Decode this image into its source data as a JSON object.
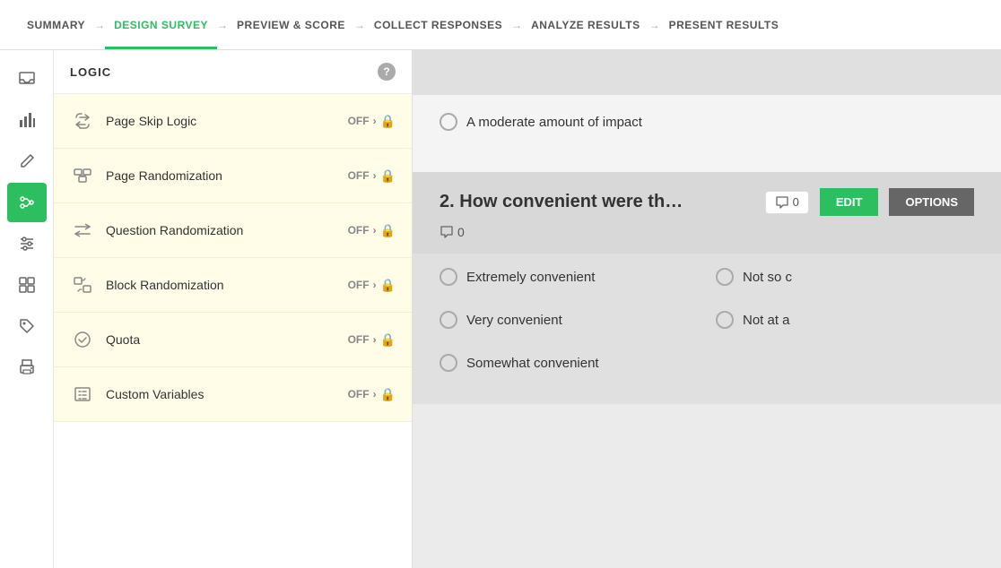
{
  "nav": {
    "items": [
      {
        "id": "summary",
        "label": "SUMMARY",
        "active": false
      },
      {
        "id": "design",
        "label": "DESIGN SURVEY",
        "active": true
      },
      {
        "id": "preview",
        "label": "PREVIEW & SCORE",
        "active": false
      },
      {
        "id": "collect",
        "label": "COLLECT RESPONSES",
        "active": false
      },
      {
        "id": "analyze",
        "label": "ANALYZE RESULTS",
        "active": false
      },
      {
        "id": "present",
        "label": "PRESENT RESULTS",
        "active": false
      }
    ]
  },
  "sidebar_icons": [
    {
      "id": "inbox",
      "icon": "⊟",
      "active": false
    },
    {
      "id": "chart",
      "icon": "▦",
      "active": false
    },
    {
      "id": "edit",
      "icon": "✎",
      "active": false
    },
    {
      "id": "logic",
      "icon": "⚡",
      "active": true
    },
    {
      "id": "settings",
      "icon": "⊞",
      "active": false
    },
    {
      "id": "grid",
      "icon": "⊞",
      "active": false
    },
    {
      "id": "tag",
      "icon": "⬡",
      "active": false
    },
    {
      "id": "print",
      "icon": "⎙",
      "active": false
    }
  ],
  "logic": {
    "title": "LOGIC",
    "help_label": "?",
    "items": [
      {
        "id": "page-skip",
        "icon": "skip",
        "label": "Page Skip Logic",
        "status": "OFF"
      },
      {
        "id": "page-randomization",
        "icon": "random",
        "label": "Page Randomization",
        "status": "OFF"
      },
      {
        "id": "question-randomization",
        "icon": "shuffle",
        "label": "Question Randomization",
        "status": "OFF"
      },
      {
        "id": "block-randomization",
        "icon": "block",
        "label": "Block Randomization",
        "status": "OFF"
      },
      {
        "id": "quota",
        "icon": "check-circle",
        "label": "Quota",
        "status": "OFF"
      },
      {
        "id": "custom-variables",
        "icon": "bracket",
        "label": "Custom Variables",
        "status": "OFF"
      }
    ]
  },
  "survey": {
    "q1": {
      "option1": "A moderate amount of impact"
    },
    "q2": {
      "number": "2.",
      "title": "How convenient were th",
      "comment_count": "0",
      "comment_icon_count": "0",
      "edit_label": "EDIT",
      "options_label": "OPTIONS",
      "options": [
        {
          "col": 1,
          "label": "Extremely convenient"
        },
        {
          "col": 2,
          "label": "Not so c"
        },
        {
          "col": 1,
          "label": "Very convenient"
        },
        {
          "col": 2,
          "label": "Not at a"
        },
        {
          "col": 1,
          "label": "Somewhat convenient"
        }
      ]
    }
  },
  "colors": {
    "active_green": "#2dbe60",
    "lock_gold": "#f0a500",
    "logic_bg": "#fffde7",
    "nav_active": "#2dbe60"
  }
}
